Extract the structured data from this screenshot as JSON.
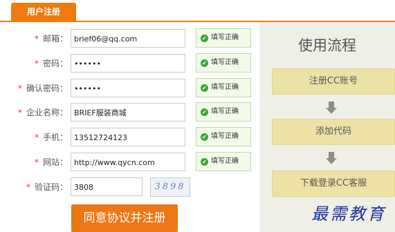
{
  "tab": {
    "label": "用户注册"
  },
  "form": {
    "rows": [
      {
        "label": "邮箱：",
        "value": "brief06@qq.com",
        "status": "填写正确"
      },
      {
        "label": "密码：",
        "value": "••••••",
        "status": "填写正确"
      },
      {
        "label": "确认密码：",
        "value": "••••••",
        "status": "填写正确"
      },
      {
        "label": "企业名称：",
        "value": "BRIEF服装商城",
        "status": "填写正确"
      },
      {
        "label": "手机：",
        "value": "13512724123",
        "status": "填写正确"
      },
      {
        "label": "网站：",
        "value": "http://www.qycn.com",
        "status": "填写正确"
      }
    ],
    "captcha": {
      "label": "验证码：",
      "value": "3808",
      "image_text": "3898"
    },
    "submit_label": "同意协议并注册",
    "required_mark": "*",
    "ok_mark": "✔"
  },
  "side": {
    "title": "使用流程",
    "steps": [
      "注册CC账号",
      "添加代码",
      "下载登录CC客服"
    ]
  },
  "watermark": "最需教育",
  "colors": {
    "accent": "#ef7a0e",
    "ok_border": "#b7dfa3",
    "ok_bg": "#f3faea",
    "step_bg": "#ede2a6"
  }
}
